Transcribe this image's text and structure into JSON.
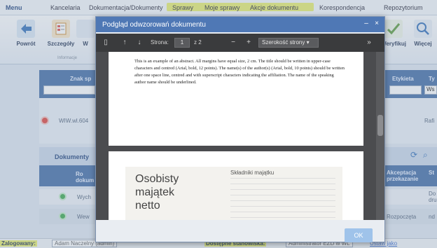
{
  "menubar": {
    "items": [
      "Menu",
      "Kancelaria",
      "Dokumentacja/Dokumenty",
      "Sprawy",
      "Moje sprawy",
      "Akcje dokumentu",
      "Korespondencja",
      "Repozytorium"
    ]
  },
  "ribbon": {
    "buttons": [
      {
        "label": "Powrót",
        "icon": "back-arrow-icon"
      },
      {
        "label": "Szczegóły",
        "icon": "details-icon"
      },
      {
        "label": "W",
        "icon": "view-icon"
      },
      {
        "label": "Weryfikuj",
        "icon": "verify-icon"
      },
      {
        "label": "Więcej",
        "icon": "search-more-icon"
      }
    ],
    "group_label": "Informacje"
  },
  "background_table": {
    "col_headers": [
      "Znak sp",
      "Etykieta",
      "Ty"
    ],
    "type_value": "Ws",
    "row1": {
      "ref": "WIW.wl.604",
      "right": "Rafi"
    },
    "section_title": "Dokumenty",
    "grid_headers": [
      "Ro dokum",
      "Akceptacja przekazanie",
      "St"
    ],
    "rows": [
      {
        "c1": "Wych",
        "c2": "",
        "c3": "Do dru"
      },
      {
        "c1": "Wew",
        "c2": "Rozpoczęta",
        "c3": "nd"
      }
    ]
  },
  "dialog": {
    "title": "Podgląd odwzorowań dokumentu",
    "min_label": "–",
    "close_label": "×",
    "ok_label": "OK"
  },
  "pdf_toolbar": {
    "page_label": "Strona:",
    "page_value": "1",
    "page_total": "z 2",
    "zoom_label": "Szerokość strony"
  },
  "page1_text": "This is an example of an abstract. All margins have equal size, 2 cm. The title should be written in upper-case characters and centred (Arial, bold, 12 points). The name(s) of the author(s) (Arial, bold, 10 points) should be written after one space line, centred and with superscript characters indicating the affiliation. The name of the speaking author name should be underlined.",
  "page2": {
    "big_title_lines": [
      "Osobisty",
      "majątek",
      "netto"
    ],
    "table_title": "Składniki majątku"
  },
  "statusbar": {
    "logged_label": "Zalogowany:",
    "logged_value": "Adam Naczelny (admin)",
    "stations_label": "Dostępne stanowiska:",
    "stations_value": "Administrator EZD w WL",
    "switch_link": "Ustaw jako"
  },
  "colors": {
    "accent": "#4f78b5",
    "highlight": "#e9ef6a",
    "pdf_dark": "#3a3b3d"
  }
}
